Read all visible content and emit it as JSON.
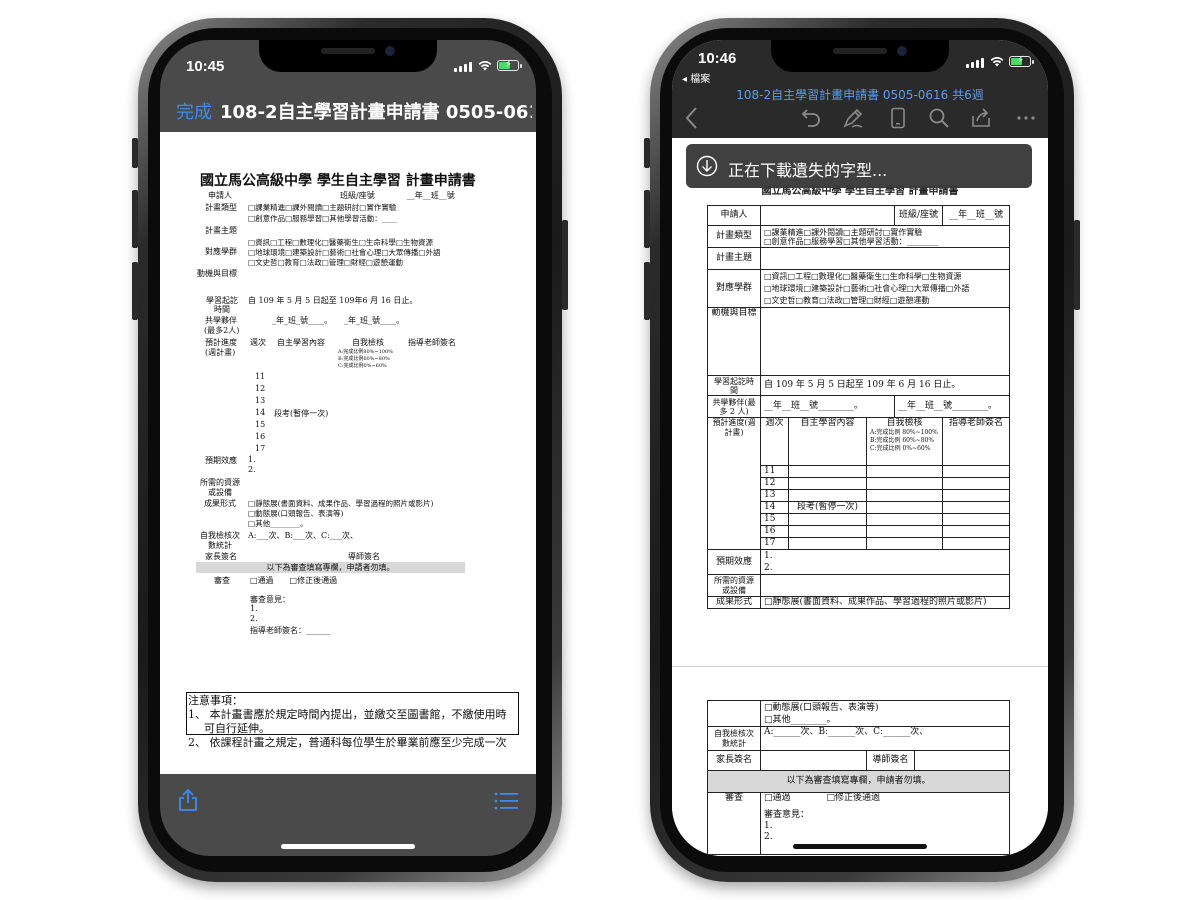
{
  "left_phone": {
    "status": {
      "time": "10:45"
    },
    "nav": {
      "done_label": "完成",
      "title": "108-2自主學習計畫申請書 0505-061..."
    },
    "document": {
      "title": "國立馬公高級中學 學生自主學習 計畫申請書",
      "rows": [
        {
          "label": "申請人",
          "value": "班級/座號　　　　__年__班__號"
        },
        {
          "label": "計畫類型",
          "value": "□課業精進□課外閱讀□主題研討□實作實驗"
        },
        {
          "label": "",
          "value": "□創意作品□服務學習□其他學習活動：____"
        },
        {
          "label": "計畫主題",
          "value": ""
        },
        {
          "label": "",
          "value": "□資訊□工程□數理化□醫藥衛生□生命科學□生物資源"
        },
        {
          "label": "對應學群",
          "value": "□地球環境□建築設計□藝術□社會心理□大眾傳播□外語"
        },
        {
          "label": "",
          "value": "□文史哲□教育□法政□管理□財經□遊憩運動"
        },
        {
          "label": "動機與目標",
          "value": ""
        }
      ],
      "period_label": "學習起訖",
      "period_label2": "時間",
      "period_value": "自 109 年 5 月 5 日起至 109年6 月 16 日止。",
      "partner_label": "共學夥伴",
      "partner_label2": "(最多2人)",
      "partner_value": "_年_班_號____。　　_年_班_號____。",
      "progress_label": "預計進度",
      "progress_label2": "(週計畫)",
      "col_week": "週次",
      "col_content": "自主學習內容",
      "col_check": "自我檢核",
      "col_teacher": "指導老師簽名",
      "check_legend": [
        "A:完成比例80%~100%",
        "B:完成比例60%~80%",
        "C:完成比例0%~60%"
      ],
      "weeks": [
        "11",
        "12",
        "13",
        "14",
        "15",
        "16",
        "17"
      ],
      "week14_note": "段考(暫停一次)",
      "effect_label": "預期效應",
      "effect_items": [
        "1.",
        "2."
      ],
      "resource_label": "所需的資源",
      "resource_label2": "或設備",
      "form_label": "成果形式",
      "form_items": [
        "□靜態展(書面資料、成果作品、學習過程的照片或影片)",
        "□動態展(口頭報告、表演等)",
        "□其他________。"
      ],
      "selfcheck_label": "自我檢核次",
      "selfcheck_label2": "數統計",
      "selfcheck_value": "A:___次、B:___次、C:___次、",
      "parent_label": "家長簽名",
      "mentor_label": "導師簽名",
      "review_banner": "以下為審查填寫專欄，申請者勿填。",
      "review_label": "審查",
      "review_options": "□通過　　□修正後通過",
      "review_opinion": "審查意見：",
      "review_items": [
        "1.",
        "2."
      ],
      "teacher_sign": "指導老師簽名：______",
      "notice_title": "注意事項：",
      "notice_1": "1、 本計畫書應於規定時間內提出，並繳交至圖書館，不繳使用時",
      "notice_1b": "可自行延伸。",
      "notice_2": "2、 依課程計畫之規定，普通科每位學生於畢業前應至少完成一次"
    }
  },
  "right_phone": {
    "status": {
      "time": "10:46",
      "back_app": "◂ 檔案"
    },
    "nav": {
      "title": "108-2自主學習計畫申請書 0505-0616 共6週"
    },
    "toast": {
      "text": "正在下載遺失的字型..."
    },
    "document": {
      "title": "國立馬公高級中學 學生自主學習 計畫申請書",
      "applicant_label": "申請人",
      "class_label": "班級/座號",
      "class_value": "__年__班__號",
      "type_label": "計畫類型",
      "type_line1": "□課業精進□課外閱讀□主題研討□實作實驗",
      "type_line2": "□創意作品□服務學習□其他學習活動：________",
      "topic_label": "計畫主題",
      "group_label": "對應學群",
      "group_lines": [
        "□資訊□工程□數理化□醫藥衛生□生命科學□生物資源",
        "□地球環境□建築設計□藝術□社會心理□大眾傳播□外語",
        "□文史哲□教育□法政□管理□財經□遊憩運動"
      ],
      "motive_label": "動機與目標",
      "period_label": "學習起訖時間",
      "period_value": "自 109 年 5 月 5 日起至 109 年 6 月 16 日止。",
      "partner_label": "共學夥伴(最多 2 人)",
      "partner_a": "__年__班__號________。",
      "partner_b": "__年__班__號________。",
      "progress_label": "預計進度(週計畫)",
      "col_week": "週次",
      "col_content": "自主學習內容",
      "col_check": "自我檢核",
      "col_teacher": "指導老師簽名",
      "check_legend": [
        "A:完成比例 80%~100%",
        "B:完成比例 60%~80%",
        "C:完成比例 0%~60%"
      ],
      "weeks": [
        "11",
        "12",
        "13",
        "14",
        "15",
        "16",
        "17"
      ],
      "week14_note": "段考(暫停一次)",
      "effect_label": "預期效應",
      "effect_items": [
        "1.",
        "2."
      ],
      "resource_label": "所需的資源或設備",
      "form_label": "成果形式",
      "form_line1": "□靜態展(書面資料、成果作品、學習過程的照片或影片)",
      "page2": {
        "form_line2": "□動態展(口頭報告、表演等)",
        "form_line3": "□其他________。",
        "selfcheck_label": "自我檢核次數統計",
        "selfcheck_value": "A:______次、B:______次、C:______次、",
        "parent_label": "家長簽名",
        "mentor_label": "導師簽名",
        "review_banner": "以下為審查填寫專欄，申請者勿填。",
        "review_label": "審查",
        "review_options": "□通過　　　　□修正後通過",
        "review_opinion": "審查意見：",
        "review_items": [
          "1.",
          "2."
        ]
      }
    }
  }
}
